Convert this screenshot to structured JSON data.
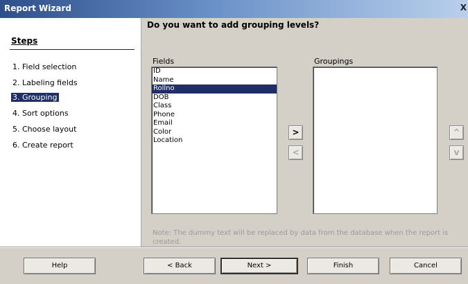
{
  "window": {
    "title": "Report Wizard",
    "close_label": "X"
  },
  "steps": {
    "heading": "Steps",
    "items": [
      {
        "label": "1. Field selection"
      },
      {
        "label": "2. Labeling fields"
      },
      {
        "label": "3. Grouping"
      },
      {
        "label": "4. Sort options"
      },
      {
        "label": "5. Choose layout"
      },
      {
        "label": "6. Create report"
      }
    ],
    "active_index": 2
  },
  "main": {
    "question": "Do you want to add grouping levels?",
    "fields_label": "Fields",
    "groupings_label": "Groupings",
    "fields": [
      "ID",
      "Name",
      "Rollno",
      "DOB",
      "Class",
      "Phone",
      "Email",
      "Color",
      "Location"
    ],
    "selected_field": "Rollno",
    "groupings": [],
    "add_label": ">",
    "remove_label": "<",
    "up_label": "^",
    "down_label": "v",
    "note": "Note: The dummy text will be replaced by data from the database when the report is created."
  },
  "buttons": {
    "help": "Help",
    "back": "< Back",
    "next": "Next >",
    "finish": "Finish",
    "cancel": "Cancel"
  }
}
